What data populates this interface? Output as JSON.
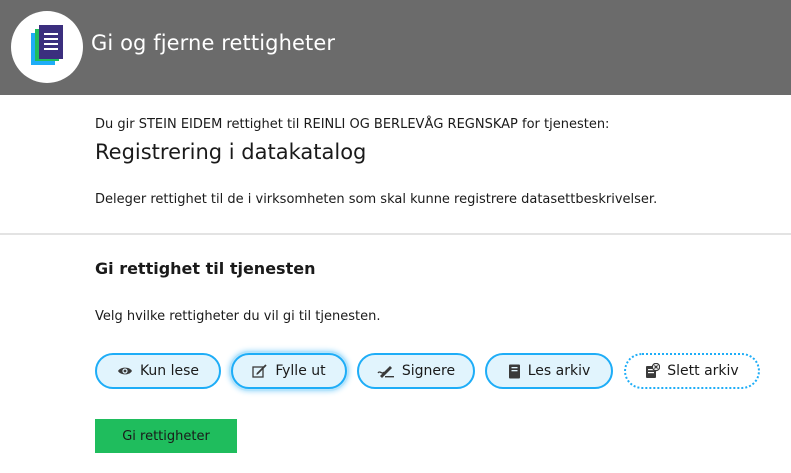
{
  "header": {
    "title": "Gi og fjerne rettigheter",
    "logo_icon": "document-stack-icon"
  },
  "intro": {
    "text": "Du gir STEIN EIDEM rettighet til REINLI OG BERLEVÅG REGNSKAP for tjenesten:",
    "service_name": "Registrering i datakatalog",
    "delegate_text": "Deleger rettighet til de i virksomheten som skal kunne registrere datasettbeskrivelser."
  },
  "grant_section": {
    "heading": "Gi rettighet til tjenesten",
    "instruction": "Velg hvilke rettigheter du vil gi til tjenesten.",
    "rights": [
      {
        "label": "Kun lese",
        "icon": "eye-icon",
        "state": "available"
      },
      {
        "label": "Fylle ut",
        "icon": "pen-form-icon",
        "state": "focused"
      },
      {
        "label": "Signere",
        "icon": "signature-icon",
        "state": "available"
      },
      {
        "label": "Les arkiv",
        "icon": "archive-book-icon",
        "state": "available"
      },
      {
        "label": "Slett arkiv",
        "icon": "delete-archive-icon",
        "state": "unselected"
      }
    ],
    "submit_label": "Gi rettigheter"
  },
  "colors": {
    "header_bg": "#6b6b6b",
    "pill_border": "#1eadf7",
    "pill_bg": "#e1f4fd",
    "submit_bg": "#1fbd5d"
  }
}
